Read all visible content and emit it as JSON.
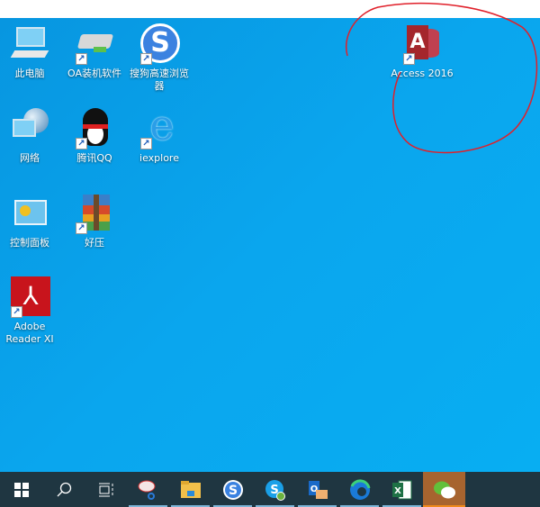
{
  "desktop": {
    "icons": [
      {
        "label": "此电脑",
        "icon": "computer-icon"
      },
      {
        "label": "OA装机软件",
        "icon": "drive-icon"
      },
      {
        "label": "搜狗高速浏览器",
        "icon": "sogou-browser-icon"
      },
      {
        "label": "网络",
        "icon": "network-icon"
      },
      {
        "label": "腾讯QQ",
        "icon": "qq-icon"
      },
      {
        "label": "iexplore",
        "icon": "ie-icon"
      },
      {
        "label": "控制面板",
        "icon": "control-panel-icon"
      },
      {
        "label": "好压",
        "icon": "haozip-icon"
      },
      {
        "label": "Adobe Reader XI",
        "icon": "adobe-reader-icon"
      },
      {
        "label": "Access 2016",
        "icon": "access-icon"
      }
    ],
    "shortcut_arrow": "↗"
  },
  "taskbar": {
    "items": [
      "start",
      "search",
      "task-view",
      "snipping-tool",
      "file-explorer",
      "sogou-browser",
      "skype",
      "outlook",
      "edge",
      "excel",
      "wechat"
    ],
    "accent": "#a7642f"
  },
  "annotation_color": "#e0202a"
}
